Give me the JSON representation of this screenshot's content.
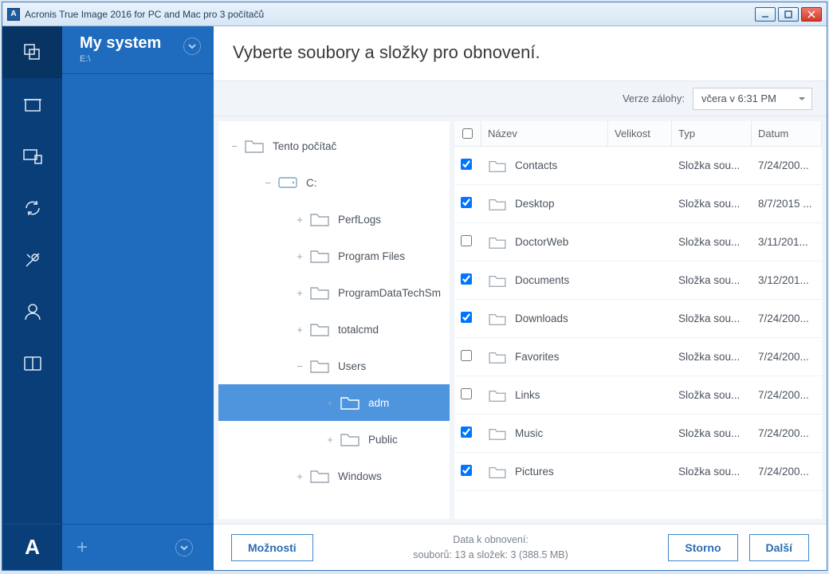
{
  "window": {
    "title": "Acronis True Image 2016 for PC and Mac pro 3 počítačů"
  },
  "sidebar": {
    "title": "My system",
    "subtitle": "E:\\"
  },
  "main": {
    "heading": "Vyberte soubory a složky pro obnovení.",
    "version_label": "Verze zálohy:",
    "version_value": "včera v 6:31 PM"
  },
  "tree": {
    "root": "Tento počítač",
    "drive": "C:",
    "folders": [
      "PerfLogs",
      "Program Files",
      "ProgramDataTechSm",
      "totalcmd",
      "Users",
      "Windows"
    ],
    "users_children": [
      "adm",
      "Public"
    ]
  },
  "list": {
    "headers": {
      "name": "Název",
      "size": "Velikost",
      "type": "Typ",
      "date": "Datum"
    },
    "rows": [
      {
        "checked": true,
        "name": "Contacts",
        "type": "Složka sou...",
        "date": "7/24/200..."
      },
      {
        "checked": true,
        "name": "Desktop",
        "type": "Složka sou...",
        "date": "8/7/2015 ..."
      },
      {
        "checked": false,
        "name": "DoctorWeb",
        "type": "Složka sou...",
        "date": "3/11/201..."
      },
      {
        "checked": true,
        "name": "Documents",
        "type": "Složka sou...",
        "date": "3/12/201..."
      },
      {
        "checked": true,
        "name": "Downloads",
        "type": "Složka sou...",
        "date": "7/24/200..."
      },
      {
        "checked": false,
        "name": "Favorites",
        "type": "Složka sou...",
        "date": "7/24/200..."
      },
      {
        "checked": false,
        "name": "Links",
        "type": "Složka sou...",
        "date": "7/24/200..."
      },
      {
        "checked": true,
        "name": "Music",
        "type": "Složka sou...",
        "date": "7/24/200..."
      },
      {
        "checked": true,
        "name": "Pictures",
        "type": "Složka sou...",
        "date": "7/24/200..."
      }
    ]
  },
  "footer": {
    "options": "Možnosti",
    "data_label": "Data k obnovení:",
    "data_summary": "souborů: 13 a složek: 3 (388.5 MB)",
    "cancel": "Storno",
    "next": "Další"
  }
}
